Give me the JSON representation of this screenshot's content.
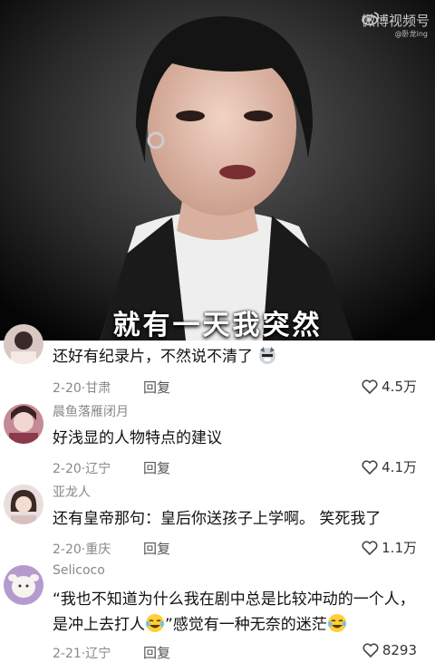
{
  "video": {
    "subtitle": "就有一天我突然",
    "watermark": "微博视频号",
    "watermark_sub": "@卧龙ing"
  },
  "comments": [
    {
      "username": "",
      "text": "还好有纪录片，不然说不清了",
      "date": "2-20",
      "location": "甘肃",
      "reply": "回复",
      "likes": "4.5万",
      "emoji": "dog-emoji"
    },
    {
      "username": "晨鱼落雁闭月",
      "text": "好浅显的人物特点的建议",
      "date": "2-20",
      "location": "辽宁",
      "reply": "回复",
      "likes": "4.1万"
    },
    {
      "username": "亚龙人",
      "text": "还有皇帝那句：皇后你送孩子上学啊。 笑死我了",
      "date": "2-20",
      "location": "重庆",
      "reply": "回复",
      "likes": "1.1万"
    },
    {
      "username": "Selicoco",
      "text_line1": "“我也不知道为什么我在剧中总是比较冲动的一个人，",
      "text_line2a": "是冲上去打人",
      "text_line2b": "”感觉有一种无奈的迷茫",
      "date": "2-21",
      "location": "辽宁",
      "reply": "回复",
      "likes": "8293",
      "emoji": "crying-laugh-emoji"
    }
  ],
  "colors": {
    "meta": "#888888",
    "text": "#111111"
  }
}
